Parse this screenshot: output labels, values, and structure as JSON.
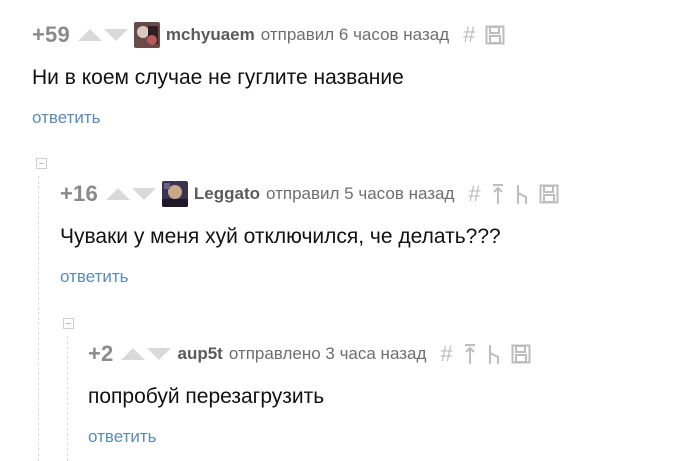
{
  "comments": [
    {
      "rating": "+59",
      "author": "mchyuaem",
      "meta": "отправил 6 часов назад",
      "hash": "#",
      "text": "Ни в коем случае не гуглите название",
      "reply": "ответить",
      "avatar_color": "#6b4a4a"
    },
    {
      "rating": "+16",
      "author": "Leggato",
      "meta": "отправил 5 часов назад",
      "hash": "#",
      "text": "Чуваки у меня хуй отключился, че делать???",
      "reply": "ответить",
      "avatar_color": "#3b3450"
    },
    {
      "rating": "+2",
      "author": "aup5t",
      "meta": "отправлено 3 часа назад",
      "hash": "#",
      "text": "попробуй перезагрузить",
      "reply": "ответить"
    }
  ],
  "colors": {
    "rating": "#8a8a8a",
    "link": "#5b8bb8",
    "icon": "#bdbdbd",
    "vote_arrow": "#d9d9d9"
  }
}
